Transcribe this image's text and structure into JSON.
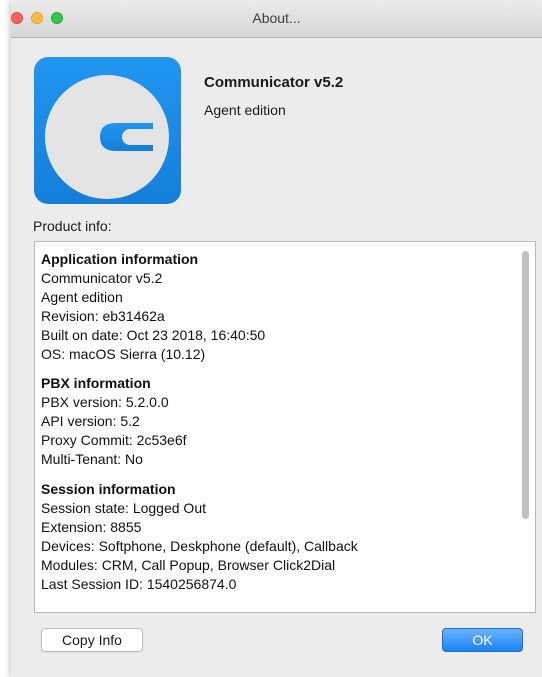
{
  "window": {
    "title": "About..."
  },
  "app": {
    "name": "Communicator v5.2",
    "edition": "Agent edition",
    "icon": "communicator-logo-icon",
    "colors": {
      "icon_bg": "#1a8ce8",
      "icon_glyph": "#e6e6e6"
    }
  },
  "product_info": {
    "label": "Product info:",
    "sections": [
      {
        "title": "Application information",
        "lines": [
          "Communicator v5.2",
          "Agent edition",
          "Revision: eb31462a",
          "Built on date: Oct 23 2018, 16:40:50",
          "OS: macOS Sierra (10.12)"
        ]
      },
      {
        "title": "PBX information",
        "lines": [
          "PBX version: 5.2.0.0",
          "API version: 5.2",
          "Proxy Commit: 2c53e6f",
          "Multi-Tenant: No"
        ]
      },
      {
        "title": "Session information",
        "lines": [
          "Session state: Logged Out",
          "Extension: 8855",
          "Devices: Softphone, Deskphone (default), Callback",
          "Modules: CRM, Call Popup, Browser Click2Dial",
          "Last Session ID: 1540256874.0"
        ]
      }
    ]
  },
  "buttons": {
    "copy_info": "Copy Info",
    "ok": "OK"
  },
  "colors": {
    "accent": "#1a82f7",
    "window_bg": "#ececec"
  }
}
